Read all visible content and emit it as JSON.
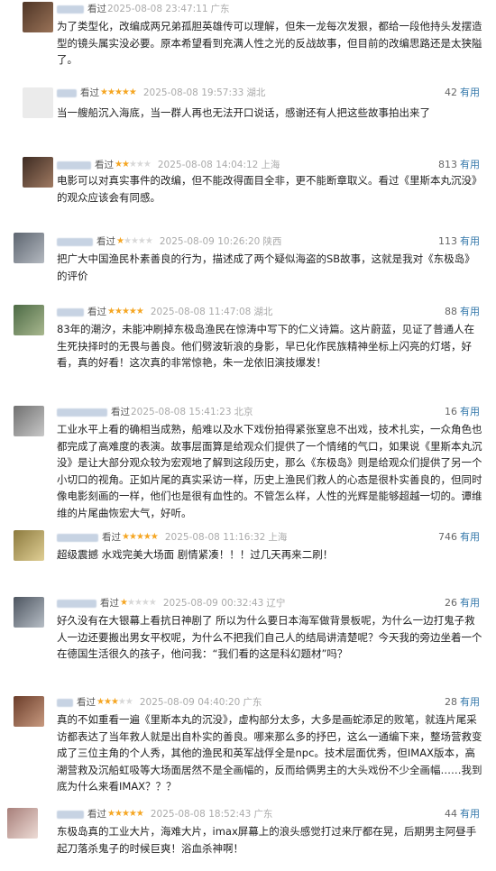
{
  "comments": [
    {
      "watched": "看过",
      "rating": 0,
      "time": "2025-08-08 23:47:11",
      "location": "广东",
      "votes": "",
      "useful_label": "",
      "text": "为了类型化，改编成两兄弟孤胆英雄传可以理解，但朱一龙每次发狠，都给一段他持头发摆造型的镜头属实没必要。原本希望看到充满人性之光的反战故事，但目前的改编思路还是太狭隘了。",
      "avatar_color": "#7a5a44"
    },
    {
      "watched": "看过",
      "rating": 5,
      "time": "2025-08-08 19:57:33",
      "location": "湖北",
      "votes": "42",
      "useful_label": "有用",
      "text": "当一艘船沉入海底，当一群人再也无法开口说话，感谢还有人把这些故事拍出来了",
      "avatar_color": "#e4e4e4"
    },
    {
      "watched": "看过",
      "rating": 2,
      "time": "2025-08-08 14:04:12",
      "location": "上海",
      "votes": "813",
      "useful_label": "有用",
      "text": "电影可以对真实事件的改编，但不能改得面目全非，更不能断章取义。看过《里斯本丸沉没》的观众应该会有同感。",
      "avatar_color": "#6b4a3a"
    },
    {
      "watched": "看过",
      "rating": 1,
      "time": "2025-08-09 10:26:20",
      "location": "陕西",
      "votes": "113",
      "useful_label": "有用",
      "text": "把广大中国渔民朴素善良的行为，描述成了两个疑似海盗的SB故事，这就是我对《东极岛》的评价",
      "avatar_color": "#8a8f96"
    },
    {
      "watched": "看过",
      "rating": 5,
      "time": "2025-08-08 11:47:08",
      "location": "湖北",
      "votes": "88",
      "useful_label": "有用",
      "text": "83年的潮汐，未能冲刷掉东极岛渔民在惊涛中写下的仁义诗篇。这片蔚蓝，见证了普通人在生死抉择时的无畏与善良。他们劈波斩浪的身影，早已化作民族精神坐标上闪亮的灯塔，好看，真的好看！这次真的非常惊艳，朱一龙依旧演技爆发！",
      "avatar_color": "#5f7a55"
    },
    {
      "watched": "看过",
      "rating": 0,
      "time": "2025-08-08 15:41:23",
      "location": "北京",
      "votes": "16",
      "useful_label": "有用",
      "text": "工业水平上看的确相当成熟，船难以及水下戏份拍得紧张窒息不出戏，技术扎实，一众角色也都完成了高难度的表演。故事层面算是给观众们提供了一个情绪的气口，如果说《里斯本丸沉没》是让大部分观众较为宏观地了解到这段历史，那么《东极岛》则是给观众们提供了另一个小切口的视角。正如片尾的真实采访一样，历史上渔民们救人的心态是很朴实善良的，但同时像电影刻画的一样，他们也是很有血性的。不管怎么样，人性的光辉是能够超越一切的。谭维维的片尾曲恢宏大气，好听。",
      "avatar_color": "#9a9a9a"
    },
    {
      "watched": "看过",
      "rating": 5,
      "time": "2025-08-08 11:16:32",
      "location": "上海",
      "votes": "746",
      "useful_label": "有用",
      "text": "超级震撼 水戏完美大场面 剧情紧凑！！！过几天再来二刷！",
      "avatar_color": "#b8a26a"
    },
    {
      "watched": "看过",
      "rating": 1,
      "time": "2025-08-09 00:32:43",
      "location": "辽宁",
      "votes": "26",
      "useful_label": "有用",
      "text": "好久没有在大银幕上看抗日神剧了 所以为什么要日本海军做背景板呢，为什么一边打鬼子救人一边还要搬出男女平权呢，为什么不把我们自己人的结局讲清楚呢？今天我的旁边坐着一个在德国生活很久的孩子，他问我：“我们看的这是科幻题材”吗？",
      "avatar_color": "#6f7780"
    },
    {
      "watched": "看过",
      "rating": 3,
      "time": "2025-08-09 04:40:20",
      "location": "广东",
      "votes": "28",
      "useful_label": "有用",
      "text": "真的不如重看一遍《里斯本丸的沉没》，虚构部分太多，大多是画蛇添足的败笔，就连片尾采访都表达了当年救人就是出自朴实的善良。哪来那么多的抒巴，这么一通编下来，整场营救变成了三位主角的个人秀，其他的渔民和英军战俘全是npc。技术层面优秀，但IMAX版本，高潮营救及沉船虹吸等大场面居然不是全画幅的，反而给俩男主的大头戏份不少全画幅……我到底为什么来看IMAX？？？",
      "avatar_color": "#8c5a44"
    },
    {
      "watched": "看过",
      "rating": 5,
      "time": "2025-08-08 18:52:43",
      "location": "广东",
      "votes": "44",
      "useful_label": "有用",
      "text": "东极岛真的工业大片，海难大片，imax屏幕上的浪头感觉打过来厅都在晃，后期男主阿昼手起刀落杀鬼子的时候巨爽！浴血杀神啊！",
      "avatar_color": "#c9a7a3"
    }
  ]
}
